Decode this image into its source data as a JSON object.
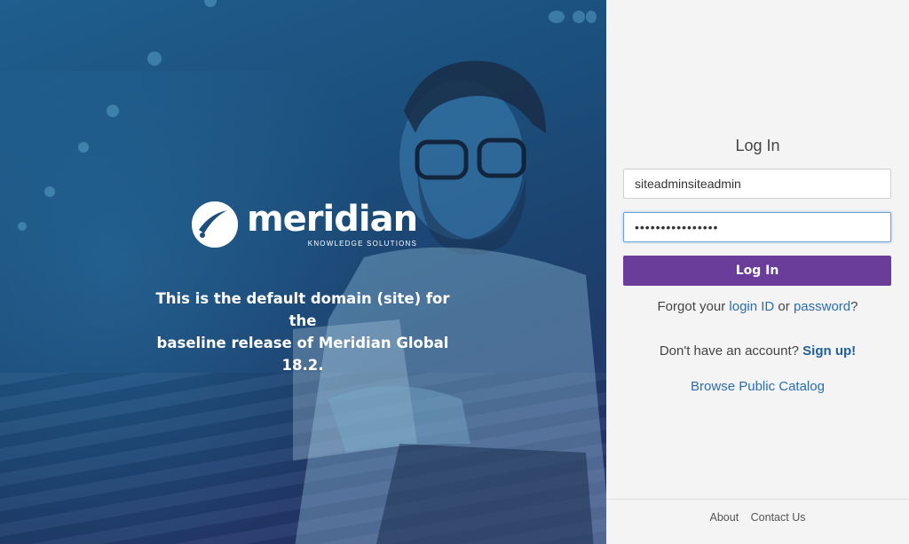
{
  "hero": {
    "logo_word": "meridian",
    "logo_sub": "KNOWLEDGE SOLUTIONS",
    "tagline_line1": "This is the default domain (site) for the",
    "tagline_line2": "baseline release of Meridian Global 18.2."
  },
  "login": {
    "title": "Log In",
    "username_value": "siteadminsiteadmin",
    "password_value": "••••••••••••••••",
    "button_label": "Log In",
    "forgot_prefix": "Forgot your",
    "forgot_login_id": "login ID",
    "forgot_or": "or",
    "forgot_password": "password",
    "forgot_suffix": "?",
    "no_account_text": "Don't have an account?",
    "signup_label": "Sign up!",
    "browse_label": "Browse Public Catalog"
  },
  "footer": {
    "about": "About",
    "contact": "Contact Us"
  },
  "colors": {
    "accent_purple": "#6a3d9a",
    "link_blue": "#2a6db0",
    "hero_blue": "#1b4f7c"
  },
  "icons": {
    "logo": "meridian-logo-icon"
  }
}
